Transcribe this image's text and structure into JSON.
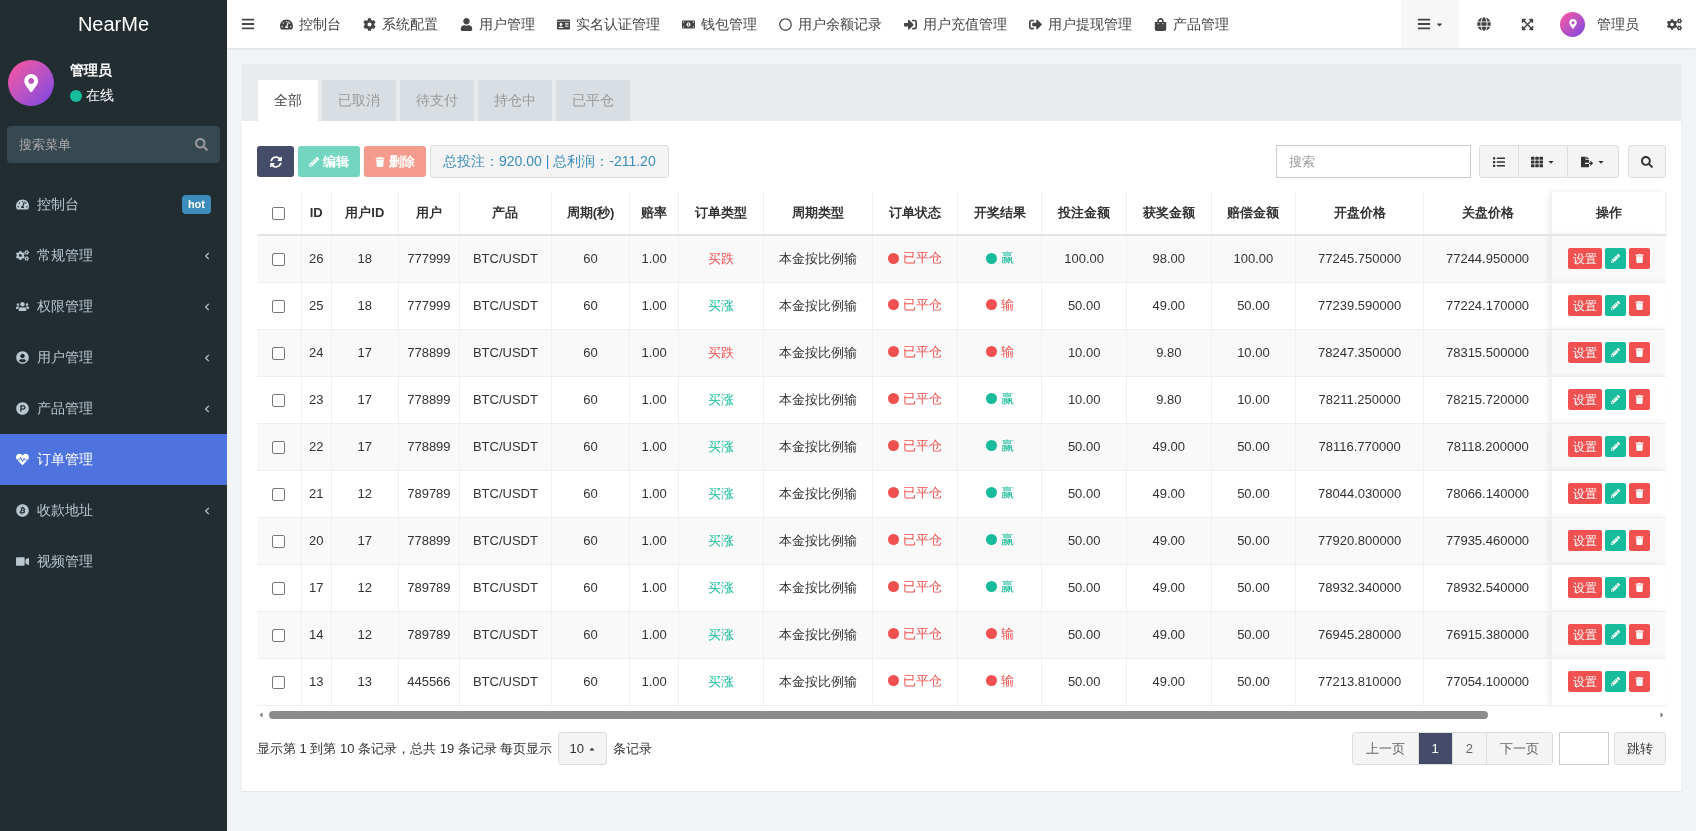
{
  "sidebar": {
    "logo": "NearMe",
    "user": {
      "name": "管理员",
      "status": "在线",
      "online": true
    },
    "search": {
      "placeholder": "搜索菜单"
    },
    "items": [
      {
        "label": "控制台",
        "badge": "hot",
        "expandable": false,
        "selected": false
      },
      {
        "label": "常规管理",
        "expandable": true,
        "selected": false
      },
      {
        "label": "权限管理",
        "expandable": true,
        "selected": false
      },
      {
        "label": "用户管理",
        "expandable": true,
        "selected": false
      },
      {
        "label": "产品管理",
        "expandable": true,
        "selected": false
      },
      {
        "label": "订单管理",
        "expandable": false,
        "selected": true
      },
      {
        "label": "收款地址",
        "expandable": true,
        "selected": false
      },
      {
        "label": "视频管理",
        "expandable": false,
        "selected": false
      }
    ]
  },
  "topbar": {
    "nav": [
      "控制台",
      "系统配置",
      "用户管理",
      "实名认证管理",
      "钱包管理",
      "用户余额记录",
      "用户充值管理",
      "用户提现管理",
      "产品管理"
    ],
    "user": "管理员"
  },
  "tabs": [
    {
      "label": "全部",
      "selected": true
    },
    {
      "label": "已取消",
      "selected": false
    },
    {
      "label": "待支付",
      "selected": false
    },
    {
      "label": "持仓中",
      "selected": false
    },
    {
      "label": "已平仓",
      "selected": false
    }
  ],
  "toolbar": {
    "edit": "编辑",
    "delete": "删除",
    "summary": "总投注：920.00 | 总利润：-211.20",
    "search": {
      "placeholder": "搜索"
    }
  },
  "table": {
    "select_all_checked": false,
    "columns": [
      "ID",
      "用户ID",
      "用户",
      "产品",
      "周期(秒)",
      "赔率",
      "订单类型",
      "周期类型",
      "订单状态",
      "开奖结果",
      "投注金额",
      "获奖金额",
      "赔偿金额",
      "开盘价格",
      "关盘价格",
      "操作"
    ],
    "rows": [
      {
        "checked": false,
        "cells": [
          "26",
          "18",
          "777999",
          "BTC/USDT",
          "60",
          "1.00"
        ],
        "order_type": {
          "text": "买跌",
          "color": "#f05050"
        },
        "cycle_type": "本金按比例输",
        "status": {
          "text": "已平仓",
          "color": "#f05050"
        },
        "result": {
          "text": "赢",
          "color": "#18bc9c"
        },
        "amounts": [
          "100.00",
          "98.00",
          "100.00",
          "77245.750000",
          "77244.950000"
        ],
        "action": "设置"
      },
      {
        "checked": false,
        "cells": [
          "25",
          "18",
          "777999",
          "BTC/USDT",
          "60",
          "1.00"
        ],
        "order_type": {
          "text": "买涨",
          "color": "#18bc9c"
        },
        "cycle_type": "本金按比例输",
        "status": {
          "text": "已平仓",
          "color": "#f05050"
        },
        "result": {
          "text": "输",
          "color": "#f05050"
        },
        "amounts": [
          "50.00",
          "49.00",
          "50.00",
          "77239.590000",
          "77224.170000"
        ],
        "action": "设置"
      },
      {
        "checked": false,
        "cells": [
          "24",
          "17",
          "778899",
          "BTC/USDT",
          "60",
          "1.00"
        ],
        "order_type": {
          "text": "买跌",
          "color": "#f05050"
        },
        "cycle_type": "本金按比例输",
        "status": {
          "text": "已平仓",
          "color": "#f05050"
        },
        "result": {
          "text": "输",
          "color": "#f05050"
        },
        "amounts": [
          "10.00",
          "9.80",
          "10.00",
          "78247.350000",
          "78315.500000"
        ],
        "action": "设置"
      },
      {
        "checked": false,
        "cells": [
          "23",
          "17",
          "778899",
          "BTC/USDT",
          "60",
          "1.00"
        ],
        "order_type": {
          "text": "买涨",
          "color": "#18bc9c"
        },
        "cycle_type": "本金按比例输",
        "status": {
          "text": "已平仓",
          "color": "#f05050"
        },
        "result": {
          "text": "赢",
          "color": "#18bc9c"
        },
        "amounts": [
          "10.00",
          "9.80",
          "10.00",
          "78211.250000",
          "78215.720000"
        ],
        "action": "设置"
      },
      {
        "checked": false,
        "cells": [
          "22",
          "17",
          "778899",
          "BTC/USDT",
          "60",
          "1.00"
        ],
        "order_type": {
          "text": "买涨",
          "color": "#18bc9c"
        },
        "cycle_type": "本金按比例输",
        "status": {
          "text": "已平仓",
          "color": "#f05050"
        },
        "result": {
          "text": "赢",
          "color": "#18bc9c"
        },
        "amounts": [
          "50.00",
          "49.00",
          "50.00",
          "78116.770000",
          "78118.200000"
        ],
        "action": "设置"
      },
      {
        "checked": false,
        "cells": [
          "21",
          "12",
          "789789",
          "BTC/USDT",
          "60",
          "1.00"
        ],
        "order_type": {
          "text": "买涨",
          "color": "#18bc9c"
        },
        "cycle_type": "本金按比例输",
        "status": {
          "text": "已平仓",
          "color": "#f05050"
        },
        "result": {
          "text": "赢",
          "color": "#18bc9c"
        },
        "amounts": [
          "50.00",
          "49.00",
          "50.00",
          "78044.030000",
          "78066.140000"
        ],
        "action": "设置"
      },
      {
        "checked": false,
        "cells": [
          "20",
          "17",
          "778899",
          "BTC/USDT",
          "60",
          "1.00"
        ],
        "order_type": {
          "text": "买涨",
          "color": "#18bc9c"
        },
        "cycle_type": "本金按比例输",
        "status": {
          "text": "已平仓",
          "color": "#f05050"
        },
        "result": {
          "text": "赢",
          "color": "#18bc9c"
        },
        "amounts": [
          "50.00",
          "49.00",
          "50.00",
          "77920.800000",
          "77935.460000"
        ],
        "action": "设置"
      },
      {
        "checked": false,
        "cells": [
          "17",
          "12",
          "789789",
          "BTC/USDT",
          "60",
          "1.00"
        ],
        "order_type": {
          "text": "买涨",
          "color": "#18bc9c"
        },
        "cycle_type": "本金按比例输",
        "status": {
          "text": "已平仓",
          "color": "#f05050"
        },
        "result": {
          "text": "赢",
          "color": "#18bc9c"
        },
        "amounts": [
          "50.00",
          "49.00",
          "50.00",
          "78932.340000",
          "78932.540000"
        ],
        "action": "设置"
      },
      {
        "checked": false,
        "cells": [
          "14",
          "12",
          "789789",
          "BTC/USDT",
          "60",
          "1.00"
        ],
        "order_type": {
          "text": "买涨",
          "color": "#18bc9c"
        },
        "cycle_type": "本金按比例输",
        "status": {
          "text": "已平仓",
          "color": "#f05050"
        },
        "result": {
          "text": "输",
          "color": "#f05050"
        },
        "amounts": [
          "50.00",
          "49.00",
          "50.00",
          "76945.280000",
          "76915.380000"
        ],
        "action": "设置"
      },
      {
        "checked": false,
        "cells": [
          "13",
          "13",
          "445566",
          "BTC/USDT",
          "60",
          "1.00"
        ],
        "order_type": {
          "text": "买涨",
          "color": "#18bc9c"
        },
        "cycle_type": "本金按比例输",
        "status": {
          "text": "已平仓",
          "color": "#f05050"
        },
        "result": {
          "text": "输",
          "color": "#f05050"
        },
        "amounts": [
          "50.00",
          "49.00",
          "50.00",
          "77213.810000",
          "77054.100000"
        ],
        "action": "设置"
      }
    ]
  },
  "footer": {
    "info_before": "显示第 1 到第 10 条记录，总共 19 条记录 每页显示",
    "page_size": "10",
    "info_after": "条记录",
    "pages": [
      {
        "label": "上一页",
        "selected": false
      },
      {
        "label": "1",
        "selected": true
      },
      {
        "label": "2",
        "selected": false
      },
      {
        "label": "下一页",
        "selected": false
      }
    ],
    "jump": "跳转"
  }
}
